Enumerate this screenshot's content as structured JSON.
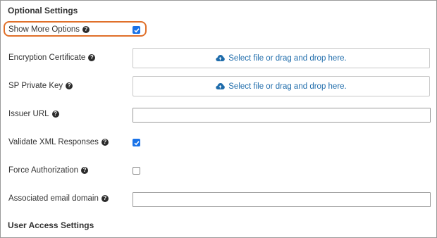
{
  "optional_settings": {
    "title": "Optional Settings"
  },
  "rows": {
    "show_more_options": {
      "label": "Show More Options",
      "checked": true
    },
    "encryption_certificate": {
      "label": "Encryption Certificate",
      "dropzone_text": "Select file or drag and drop here."
    },
    "sp_private_key": {
      "label": "SP Private Key",
      "dropzone_text": "Select file or drag and drop here."
    },
    "issuer_url": {
      "label": "Issuer URL",
      "value": ""
    },
    "validate_xml": {
      "label": "Validate XML Responses",
      "checked": true
    },
    "force_authorization": {
      "label": "Force Authorization",
      "checked": false
    },
    "email_domain": {
      "label": "Associated email domain",
      "value": ""
    }
  },
  "user_access_settings": {
    "title": "User Access Settings"
  },
  "icons": {
    "help": "question-circle-icon",
    "upload": "cloud-upload-icon",
    "check": "checkmark-icon"
  },
  "colors": {
    "highlight": "#e0702a",
    "checkbox_checked": "#1a73e8",
    "link": "#1f6cab"
  }
}
